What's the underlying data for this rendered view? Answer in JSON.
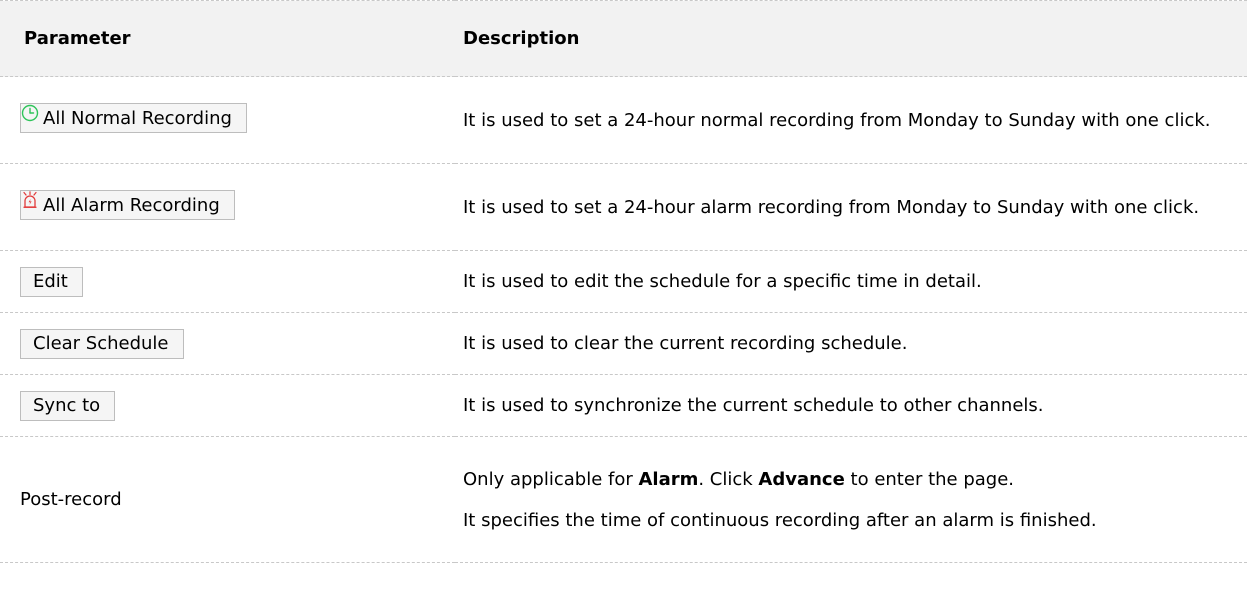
{
  "table": {
    "headers": {
      "parameter": "Parameter",
      "description": "Description"
    },
    "rows": [
      {
        "param_label": "All Normal Recording",
        "icon": "clock-icon",
        "description": "It is used to set a 24-hour normal recording from Monday to Sunday with one click."
      },
      {
        "param_label": "All Alarm Recording",
        "icon": "alarm-icon",
        "description": "It is used to set a 24-hour alarm recording from Monday to Sunday with one click."
      },
      {
        "param_label": "Edit",
        "description": "It is used to edit the schedule for a specific time in detail."
      },
      {
        "param_label": "Clear Schedule",
        "description": "It is used to clear the current recording schedule."
      },
      {
        "param_label": "Sync to",
        "description": "It is used to synchronize the current schedule to other channels."
      },
      {
        "param_label": "Post-record",
        "description_line1": {
          "part1": "Only applicable for ",
          "bold1": "Alarm",
          "part2": ". Click ",
          "bold2": "Advance",
          "part3": " to enter the page."
        },
        "description_line2": "It specifies the time of continuous recording after an alarm is finished."
      }
    ]
  },
  "colors": {
    "header_bg": "#f2f2f2",
    "clock_icon": "#2fc45a",
    "alarm_icon": "#e23b3b",
    "button_border": "#bdbdbd",
    "button_bg": "#f5f5f5"
  }
}
